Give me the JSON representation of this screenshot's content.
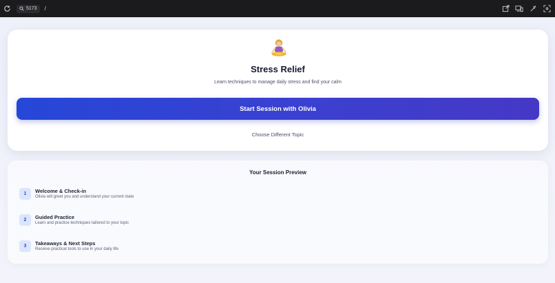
{
  "browser": {
    "port": "5173",
    "path": "/"
  },
  "topic": {
    "title": "Stress Relief",
    "subtitle": "Learn techniques to manage daily stress and find your calm",
    "start_button": "Start Session with Olivia",
    "choose_link": "Choose Different Topic"
  },
  "preview": {
    "title": "Your Session Preview",
    "steps": [
      {
        "num": "1",
        "title": "Welcome & Check-in",
        "desc": "Olivia will greet you and understand your current state"
      },
      {
        "num": "2",
        "title": "Guided Practice",
        "desc": "Learn and practice techniques tailored to your topic"
      },
      {
        "num": "3",
        "title": "Takeaways & Next Steps",
        "desc": "Receive practical tools to use in your daily life"
      }
    ]
  },
  "icons": {
    "avatar": "meditating-person-icon",
    "reload": "reload-icon",
    "address": "search-icon",
    "toolbar": [
      "open-external-icon",
      "devices-icon",
      "extensions-icon",
      "fullscreen-icon"
    ]
  },
  "colors": {
    "accent_start": "#2547d8",
    "accent_end": "#4638c6",
    "step_badge_bg": "#dce6fb",
    "step_badge_text": "#2c53c9"
  }
}
